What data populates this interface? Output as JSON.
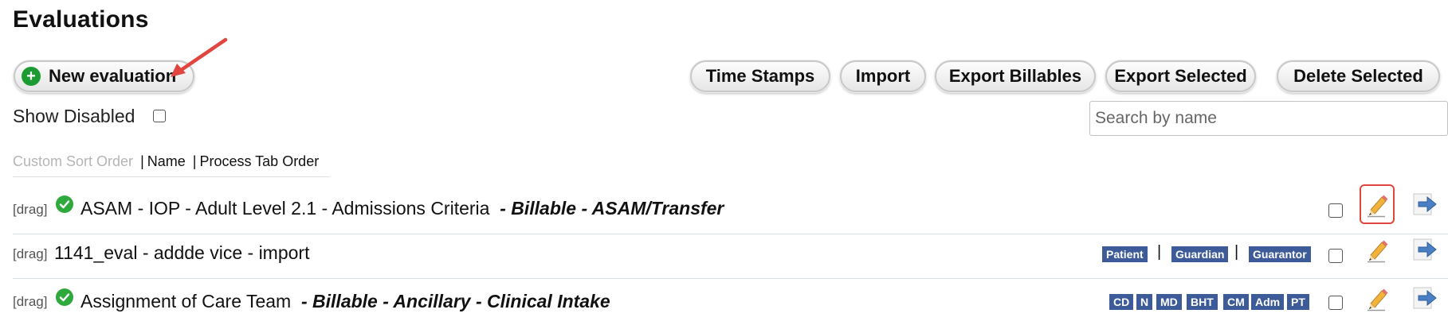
{
  "page": {
    "title": "Evaluations"
  },
  "toolbar": {
    "new_label": "New evaluation",
    "time_stamps_label": "Time Stamps",
    "import_label": "Import",
    "export_billables_label": "Export Billables",
    "export_selected_label": "Export Selected",
    "delete_selected_label": "Delete Selected"
  },
  "filters": {
    "show_disabled_label": "Show Disabled",
    "show_disabled_checked": false,
    "search_placeholder": "Search by name",
    "search_value": ""
  },
  "sort": {
    "custom": "Custom Sort Order",
    "separator": "|",
    "name": "Name",
    "process_tab": "Process Tab Order"
  },
  "rows": [
    {
      "drag": "[drag]",
      "enabled_icon": "check-circle-icon",
      "name": "ASAM - IOP - Adult Level 2.1 - Admissions Criteria",
      "tags_text": "- Billable - ASAM/Transfer",
      "badges": [],
      "checked": false
    },
    {
      "drag": "[drag]",
      "enabled_icon": "",
      "name": "1141_eval - addde vice - import",
      "tags_text": "",
      "badges": [
        "Patient",
        "Guardian",
        "Guarantor"
      ],
      "checked": false
    },
    {
      "drag": "[drag]",
      "enabled_icon": "check-circle-icon",
      "name": "Assignment of Care Team",
      "tags_text": "- Billable  - Ancillary - Clinical Intake",
      "badges": [
        "CD",
        "N",
        "MD",
        "BHT",
        "CM",
        "Adm",
        "PT"
      ],
      "checked": false
    }
  ],
  "icons": {
    "add": "plus-circle-icon",
    "edit": "pencil-icon",
    "goto": "arrow-right-icon"
  },
  "colors": {
    "badge": "#3d5a99",
    "enabled_check": "#2eaa3c",
    "add_icon": "#1c9b33",
    "annotation": "#e0463f"
  }
}
